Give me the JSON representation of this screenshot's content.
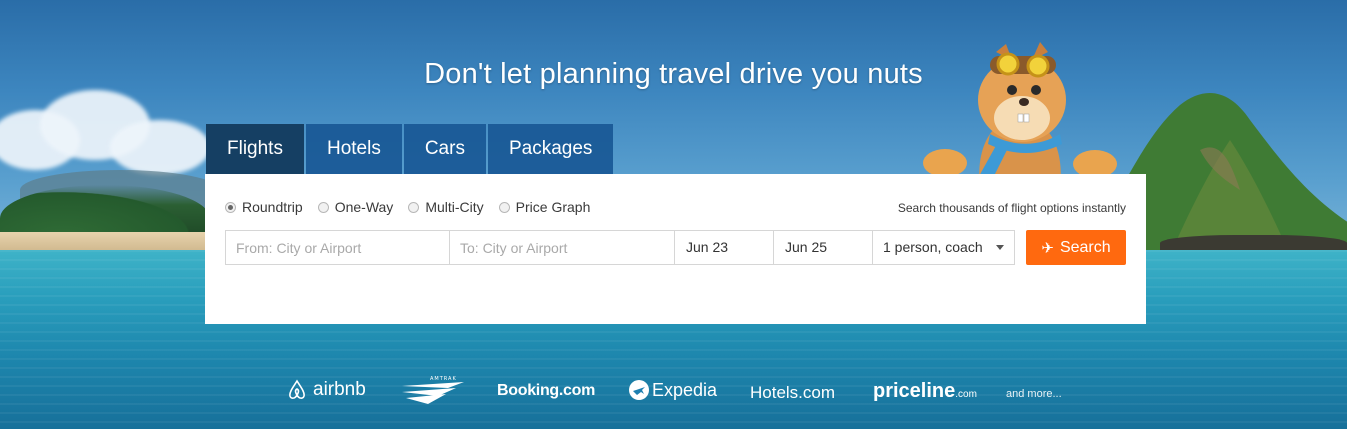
{
  "headline": "Don't let planning travel drive you nuts",
  "tabs": [
    {
      "label": "Flights",
      "active": true
    },
    {
      "label": "Hotels",
      "active": false
    },
    {
      "label": "Cars",
      "active": false
    },
    {
      "label": "Packages",
      "active": false
    }
  ],
  "trip_options": [
    {
      "label": "Roundtrip",
      "selected": true
    },
    {
      "label": "One-Way",
      "selected": false
    },
    {
      "label": "Multi-City",
      "selected": false
    },
    {
      "label": "Price Graph",
      "selected": false
    }
  ],
  "tagline": "Search thousands of flight options instantly",
  "fields": {
    "from_placeholder": "From: City or Airport",
    "to_placeholder": "To: City or Airport",
    "depart_date": "Jun 23",
    "return_date": "Jun 25",
    "travellers": "1 person, coach"
  },
  "search_button": "Search",
  "partners": {
    "airbnb": "airbnb",
    "amtrak": "AMTRAK",
    "booking": "Booking.com",
    "expedia": "Expedia",
    "hotels": "Hotels.com",
    "priceline": "priceline",
    "priceline_suffix": ".com",
    "more": "and more..."
  },
  "colors": {
    "tab_active": "#153f63",
    "tab": "#1f5a96",
    "search_button": "#ff690f",
    "panel": "#ffffff"
  }
}
